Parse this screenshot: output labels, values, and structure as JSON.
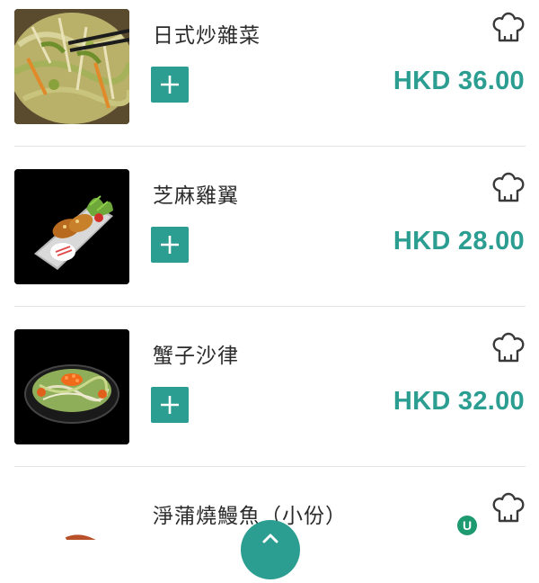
{
  "menu": {
    "items": [
      {
        "name": "日式炒雜菜",
        "price": "HKD 36.00",
        "add_icon": "plus-icon",
        "chef_icon": "chef-hat-icon"
      },
      {
        "name": "芝麻雞翼",
        "price": "HKD 28.00",
        "add_icon": "plus-icon",
        "chef_icon": "chef-hat-icon"
      },
      {
        "name": "蟹子沙律",
        "price": "HKD 32.00",
        "add_icon": "plus-icon",
        "chef_icon": "chef-hat-icon"
      },
      {
        "name": "淨蒲燒鰻魚（小份）",
        "price": "",
        "add_icon": "plus-icon",
        "chef_icon": "chef-hat-icon"
      }
    ]
  },
  "overlay": {
    "badge_text": "U",
    "scroll_icon": "chevron-up-icon"
  },
  "colors": {
    "accent": "#2b9d91",
    "text": "#2b2b2b",
    "divider": "#e3e3e3"
  }
}
